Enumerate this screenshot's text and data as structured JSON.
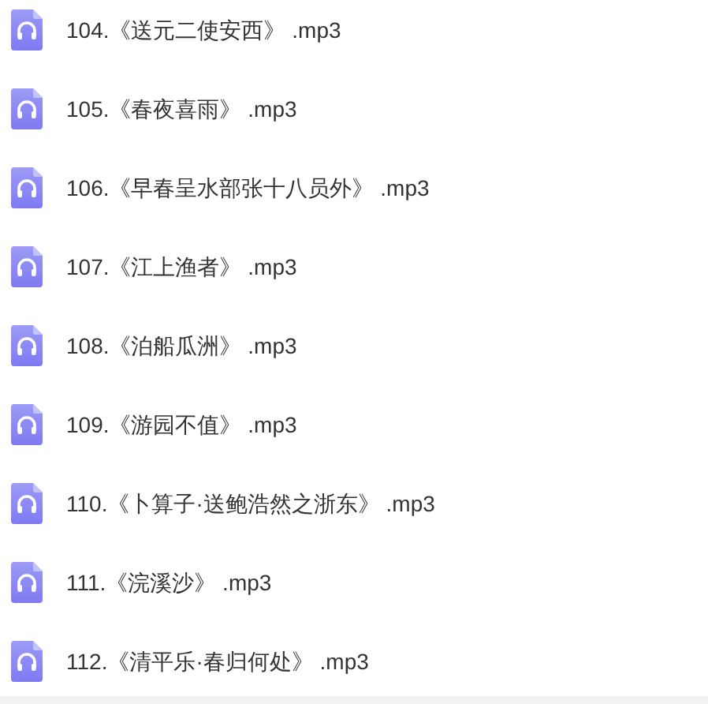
{
  "files": [
    {
      "name": "104.《送元二使安西》 .mp3"
    },
    {
      "name": "105.《春夜喜雨》 .mp3"
    },
    {
      "name": "106.《早春呈水部张十八员外》 .mp3"
    },
    {
      "name": "107.《江上渔者》 .mp3"
    },
    {
      "name": "108.《泊船瓜洲》 .mp3"
    },
    {
      "name": "109.《游园不值》 .mp3"
    },
    {
      "name": "110.《卜算子·送鲍浩然之浙东》 .mp3"
    },
    {
      "name": "111.《浣溪沙》 .mp3"
    },
    {
      "name": "112.《清平乐·春归何处》 .mp3"
    }
  ]
}
